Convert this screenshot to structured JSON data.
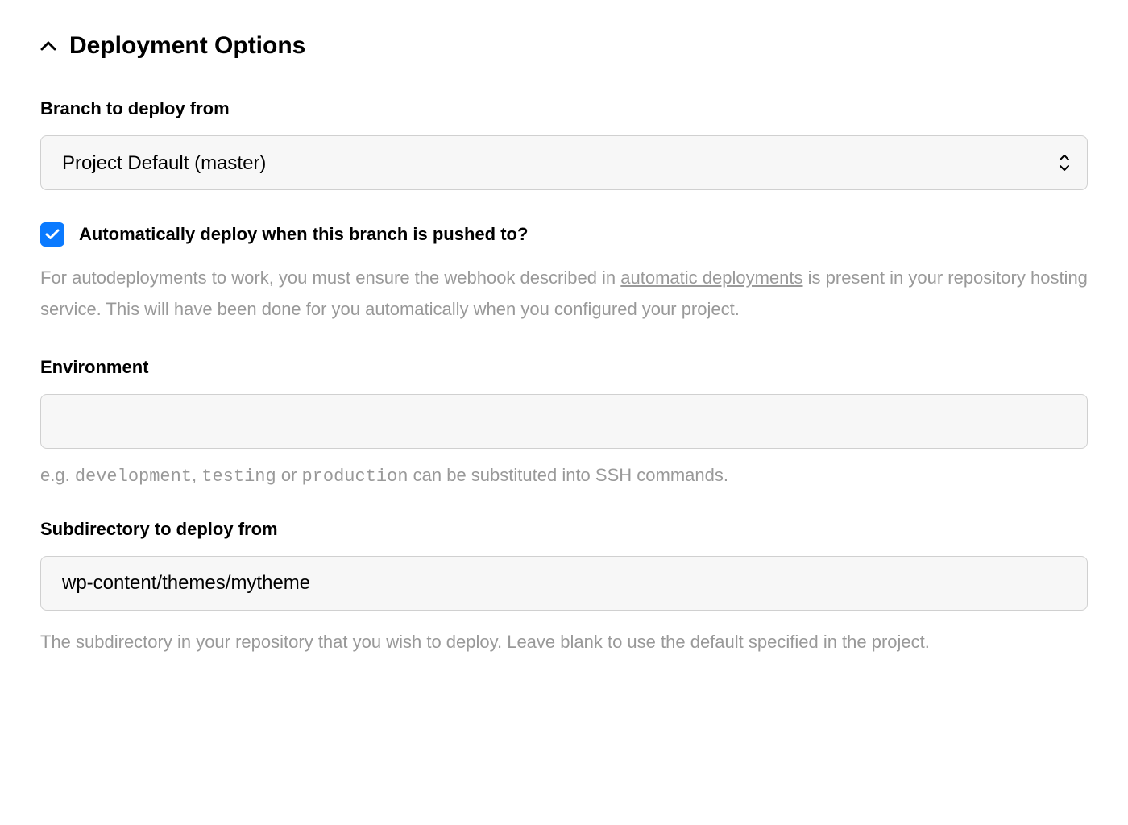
{
  "section": {
    "title": "Deployment Options"
  },
  "branch": {
    "label": "Branch to deploy from",
    "value": "Project Default (master)"
  },
  "autodeploy": {
    "checked": true,
    "label": "Automatically deploy when this branch is pushed to?",
    "help_prefix": "For autodeployments to work, you must ensure the webhook described in ",
    "help_link": "automatic deployments",
    "help_suffix": " is present in your repository hosting service. This will have been done for you automatically when you configured your project."
  },
  "environment": {
    "label": "Environment",
    "value": "",
    "help_prefix": "e.g. ",
    "help_code1": "development",
    "help_sep1": ", ",
    "help_code2": "testing",
    "help_sep2": " or ",
    "help_code3": "production",
    "help_suffix": " can be substituted into SSH commands."
  },
  "subdirectory": {
    "label": "Subdirectory to deploy from",
    "value": "wp-content/themes/mytheme",
    "help": "The subdirectory in your repository that you wish to deploy. Leave blank to use the default specified in the project."
  }
}
